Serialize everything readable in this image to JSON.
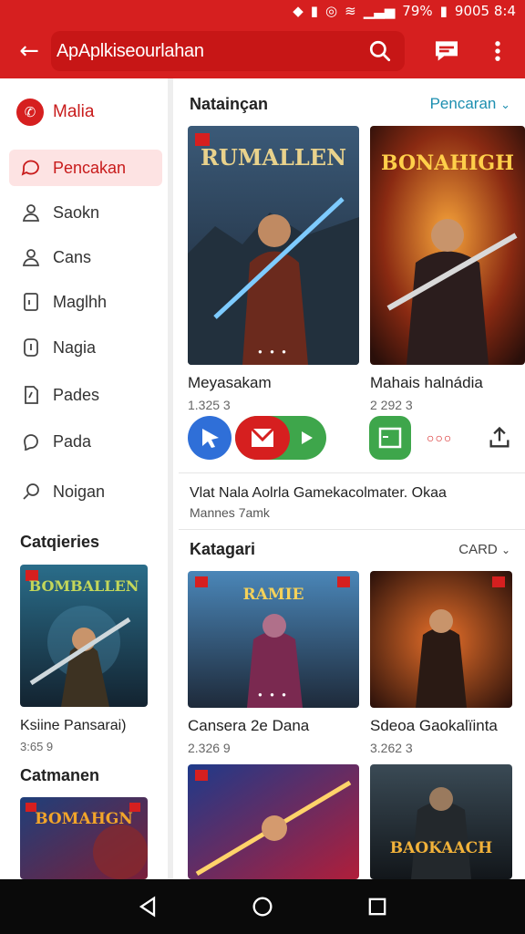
{
  "status": {
    "time": "9005 8:4",
    "battery": "79%"
  },
  "appbar": {
    "search_text": "ApAplkiseourlahan"
  },
  "sidebar": {
    "header": "Malia",
    "items": [
      {
        "label": "Pencakan",
        "icon": "chat-icon",
        "active": true
      },
      {
        "label": "Saokn",
        "icon": "person-icon"
      },
      {
        "label": "Cans",
        "icon": "person-icon"
      },
      {
        "label": "Maglhh",
        "icon": "tablet-icon"
      },
      {
        "label": "Nagia",
        "icon": "info-icon"
      },
      {
        "label": "Pades",
        "icon": "document-icon"
      },
      {
        "label": "Pada",
        "icon": "leaf-icon"
      },
      {
        "label": "Noigan",
        "icon": "search-icon"
      }
    ],
    "sections": [
      {
        "title": "Catqieries",
        "card_title": "Ksiine Pansarai)",
        "card_meta": "3:65 9",
        "art_text": "BOMBALLEN"
      },
      {
        "title": "Catmanen",
        "art_text": "BOMAHGN"
      }
    ]
  },
  "main": {
    "section1": {
      "title": "Natainçan",
      "link": "Pencaran",
      "cards": [
        {
          "art_text": "RUMALLEN",
          "title": "Meyasakam",
          "meta": "1.325 3"
        },
        {
          "art_text": "BONAHIGH",
          "title": "Mahais halnádia",
          "meta": "2 292 3"
        }
      ],
      "desc": "Vlat Nala Aolrla Gamekacolmater. Okaa",
      "desc_sub": "Mannes 7amk"
    },
    "section2": {
      "title": "Katagari",
      "link": "CARD",
      "cards": [
        {
          "art_text": "RAMIE",
          "title": "Cansera 2e Dana",
          "meta": "2.326 9"
        },
        {
          "art_text": "",
          "title": "Sdeoa Gaokalïinta",
          "meta": "3.262 3"
        },
        {
          "art_text": "",
          "title": "",
          "meta": ""
        },
        {
          "art_text": "BAOKAACH",
          "title": "",
          "meta": ""
        }
      ]
    }
  },
  "colors": {
    "brand": "#d61f1f",
    "link": "#1d8fb0",
    "blue": "#2f6fd8",
    "green": "#3ea64b"
  }
}
